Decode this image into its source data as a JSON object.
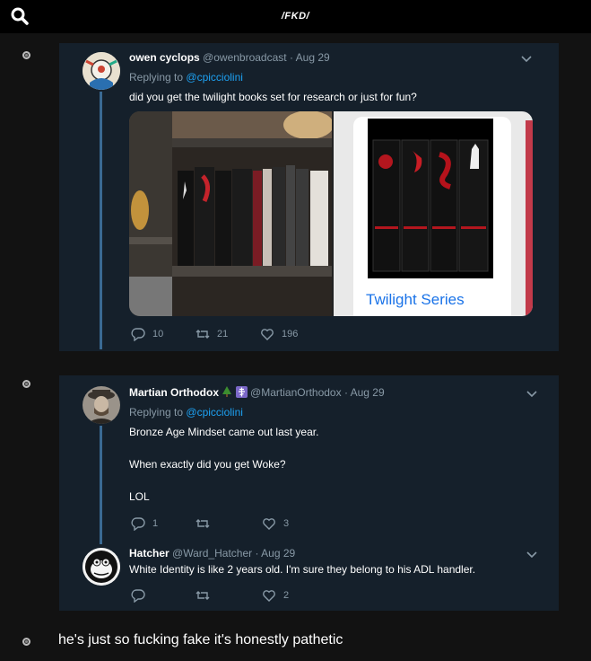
{
  "board": {
    "title": "/FKD/",
    "search_icon": "search-icon"
  },
  "post1": {
    "tweet": {
      "name": "owen cyclops",
      "handle": "@owenbroadcast",
      "date": "· Aug 29",
      "replying_prefix": "Replying to",
      "replying_handle": "@cpicciolini",
      "text": "did you get the twilight books set for research or just for fun?",
      "card_title": "Twilight Series",
      "replies": "10",
      "retweets": "21",
      "likes": "196"
    }
  },
  "post2": {
    "tweet1": {
      "name": "Martian Orthodox",
      "handle": "@MartianOrthodox",
      "date": "· Aug 29",
      "replying_prefix": "Replying to",
      "replying_handle": "@cpicciolini",
      "line1": "Bronze Age Mindset came out last year.",
      "line2": "When exactly did you get Woke?",
      "line3": "LOL",
      "replies": "1",
      "retweets": "",
      "likes": "3"
    },
    "tweet2": {
      "name": "Hatcher",
      "handle": "@Ward_Hatcher",
      "date": "· Aug 29",
      "text": "White Identity is like 2 years old. I'm sure they belong to his ADL handler.",
      "replies": "",
      "retweets": "",
      "likes": "2"
    }
  },
  "post3": {
    "text": "he's just so fucking fake it's honestly pathetic"
  },
  "colors": {
    "accent": "#1da1f2",
    "tweet_bg": "#15202b",
    "muted": "#8899a6",
    "thread": "#3a6a93"
  }
}
